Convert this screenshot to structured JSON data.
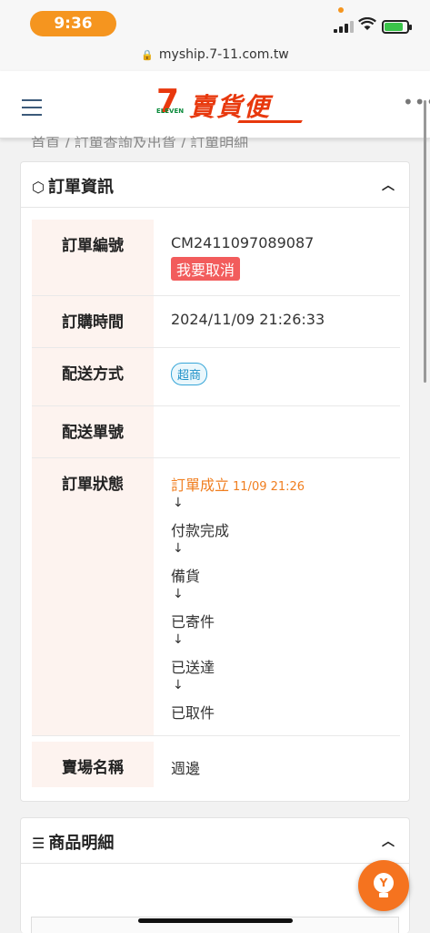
{
  "status_bar": {
    "time": "9:36"
  },
  "browser": {
    "url": "myship.7-11.com.tw"
  },
  "header": {
    "logo_text": "賣貨便",
    "logo_seven": "7",
    "logo_eleven": "ELEVEN",
    "more": "•••"
  },
  "breadcrumb": "首頁 / 訂單查詢及出貨 / 訂單明細",
  "order_card": {
    "title": "訂單資訊",
    "rows": {
      "order_no": {
        "label": "訂單編號",
        "value": "CM2411097089087",
        "cancel_label": "我要取消"
      },
      "order_time": {
        "label": "訂購時間",
        "value": "2024/11/09 21:26:33"
      },
      "delivery_method": {
        "label": "配送方式",
        "tag": "超商"
      },
      "delivery_no": {
        "label": "配送單號",
        "value": ""
      },
      "order_status": {
        "label": "訂單狀態",
        "steps": [
          {
            "text": "訂單成立",
            "time": "11/09 21:26"
          },
          {
            "text": "付款完成"
          },
          {
            "text": "備貨"
          },
          {
            "text": "已寄件"
          },
          {
            "text": "已送達"
          },
          {
            "text": "已取件"
          }
        ],
        "arrow": "↓"
      },
      "store_name": {
        "label": "賣場名稱",
        "value": "週邊"
      }
    }
  },
  "product_card": {
    "title": "商品明細"
  },
  "colors": {
    "accent": "#f5731f",
    "brand_red": "#e8380d",
    "label_bg": "#fdf3ef",
    "cancel": "#f25c5c",
    "tag_blue": "#37a6d8"
  }
}
